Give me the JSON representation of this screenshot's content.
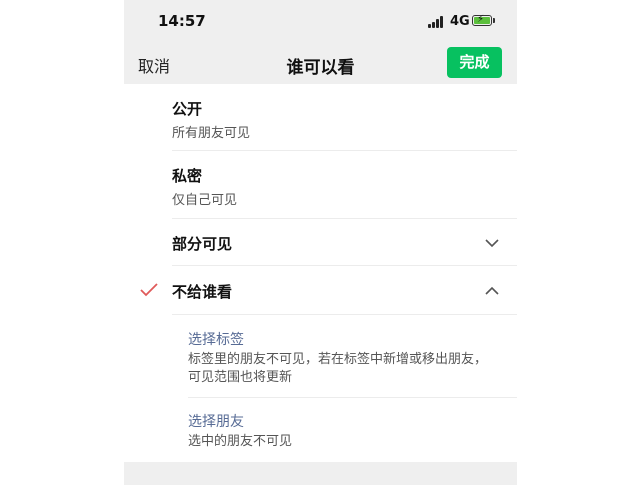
{
  "status_bar": {
    "time": "14:57",
    "network": "4G",
    "battery_state": "charging",
    "battery_color": "#5bbf3c"
  },
  "nav": {
    "cancel_label": "取消",
    "title": "谁可以看",
    "done_label": "完成",
    "done_color": "#07c160"
  },
  "options": [
    {
      "label": "公开",
      "description": "所有朋友可见"
    },
    {
      "label": "私密",
      "description": "仅自己可见"
    },
    {
      "label": "部分可见",
      "expand_icon": "chevron-down-icon"
    },
    {
      "label": "不给谁看",
      "selected": true,
      "expand_icon": "chevron-up-icon"
    }
  ],
  "sub_options": [
    {
      "label": "选择标签",
      "description_line1": "标签里的朋友不可见，若在标签中新增或移出朋友，",
      "description_line2": "可见范围也将更新"
    },
    {
      "label": "选择朋友",
      "description": "选中的朋友不可见"
    }
  ],
  "colors": {
    "check": "#e05a5a",
    "link": "#576b95"
  }
}
